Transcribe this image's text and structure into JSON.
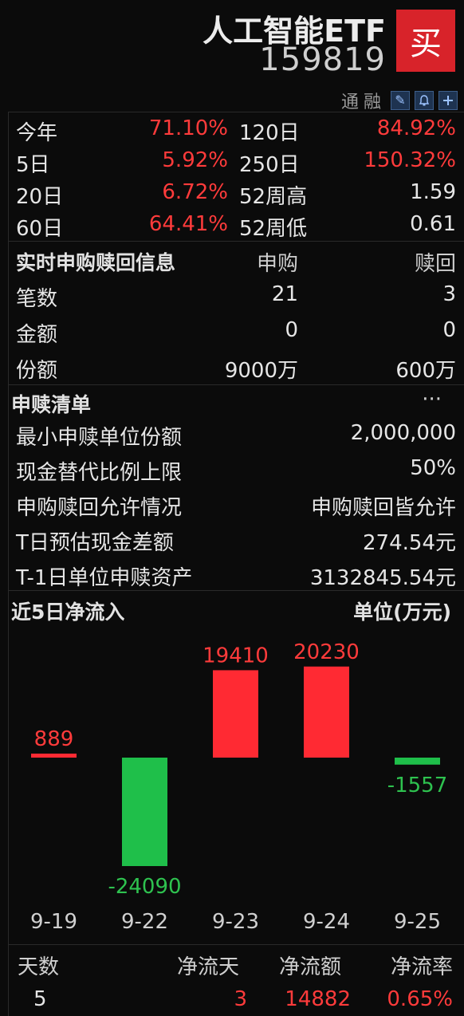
{
  "header": {
    "name": "人工智能ETF",
    "code": "159819",
    "buy_label": "买",
    "tool_tong": "通",
    "tool_rong": "融",
    "icons": [
      "edit-icon",
      "bell-icon",
      "plus-icon"
    ]
  },
  "performance": [
    {
      "label": "今年",
      "value": "71.10%",
      "label2": "120日",
      "value2": "84.92%"
    },
    {
      "label": "5日",
      "value": "5.92%",
      "label2": "250日",
      "value2": "150.32%"
    },
    {
      "label": "20日",
      "value": "6.72%",
      "label2": "52周高",
      "value2": "1.59"
    },
    {
      "label": "60日",
      "value": "64.41%",
      "label2": "52周低",
      "value2": "0.61"
    }
  ],
  "realtime": {
    "title": "实时申购赎回信息",
    "col_subscribe": "申购",
    "col_redeem": "赎回",
    "rows": [
      {
        "label": "笔数",
        "subscribe": "21",
        "redeem": "3"
      },
      {
        "label": "金额",
        "subscribe": "0",
        "redeem": "0"
      },
      {
        "label": "份额",
        "subscribe": "9000万",
        "redeem": "600万"
      }
    ]
  },
  "redemption_list": {
    "title": "申赎清单",
    "more": "···",
    "rows": [
      {
        "label": "最小申赎单位份额",
        "value": "2,000,000"
      },
      {
        "label": "现金替代比例上限",
        "value": "50%"
      },
      {
        "label": "申购赎回允许情况",
        "value": "申购赎回皆允许"
      },
      {
        "label": "T日预估现金差额",
        "value": "274.54元"
      },
      {
        "label": "T-1日单位申赎资产",
        "value": "3132845.54元"
      }
    ]
  },
  "net_flow": {
    "title": "近5日净流入",
    "unit": "单位(万元)"
  },
  "chart_data": {
    "type": "bar",
    "categories": [
      "9-19",
      "9-22",
      "9-23",
      "9-24",
      "9-25"
    ],
    "values": [
      889,
      -24090,
      19410,
      20230,
      -1557
    ],
    "labels": [
      "889",
      "-24090",
      "19410",
      "20230",
      "-1557"
    ],
    "xlabel": "",
    "ylabel": "",
    "colors": {
      "positive": "#ff2a33",
      "negative": "#1fbf4a",
      "positive_text": "#ff3b3b",
      "negative_text": "#2ec24f"
    }
  },
  "summary": {
    "headers": [
      "天数",
      "净流天",
      "净流额",
      "净流率"
    ],
    "values": [
      "5",
      "3",
      "14882",
      "0.65%"
    ]
  }
}
